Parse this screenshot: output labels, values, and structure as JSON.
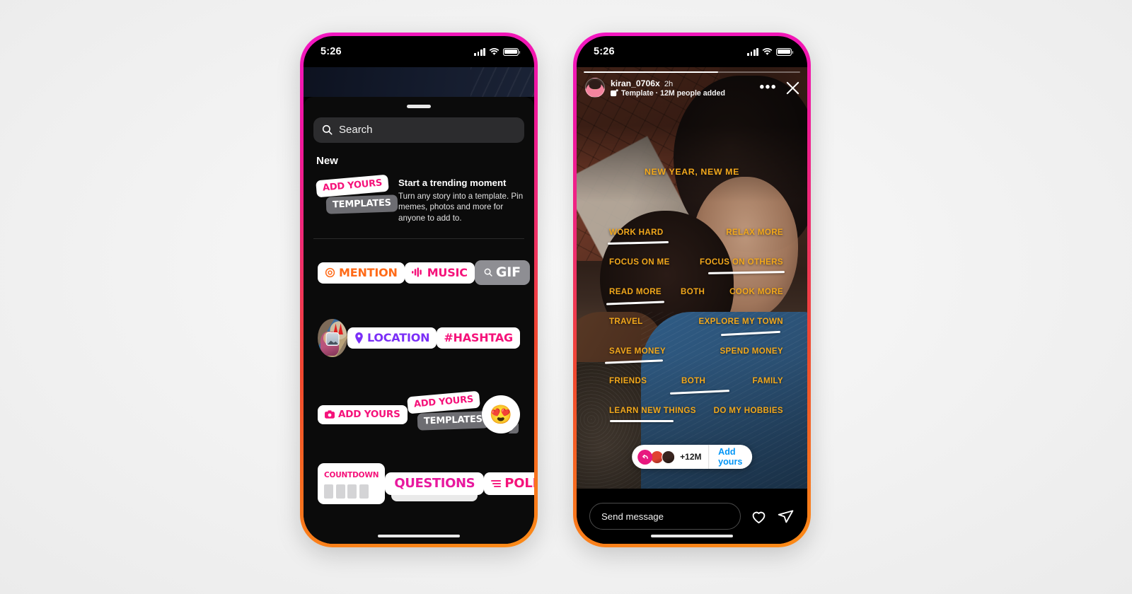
{
  "left_phone": {
    "status_bar": {
      "time": "5:26",
      "signal_icon": "cellular-bars-icon",
      "wifi_icon": "wifi-icon",
      "battery_icon": "battery-full-icon"
    },
    "sheet": {
      "grabber": "drag-handle",
      "search": {
        "placeholder": "Search",
        "icon": "search-icon"
      },
      "section_title": "New",
      "promo": {
        "sticker_top_label": "ADD YOURS",
        "sticker_bottom_label": "TEMPLATES",
        "title": "Start a trending moment",
        "body": "Turn any story into a template. Pin memes, photos and more for anyone to add to."
      },
      "stickers": {
        "row1": [
          {
            "name": "mention-sticker",
            "label": "MENTION",
            "icon": "at-threads-icon",
            "color": "#ff6a17"
          },
          {
            "name": "music-sticker",
            "label": "MUSIC",
            "icon": "music-waveform-icon",
            "color": "#f5127a"
          },
          {
            "name": "gif-sticker",
            "label": "GIF",
            "icon": "search-icon",
            "color": "#ffffff"
          }
        ],
        "row2": [
          {
            "name": "selfie-sticker",
            "label": "",
            "icon": "photo-collage-icon"
          },
          {
            "name": "location-sticker",
            "label": "LOCATION",
            "icon": "pin-icon",
            "color": "#7b2ff7"
          },
          {
            "name": "hashtag-sticker",
            "label": "#HASHTAG",
            "icon": "",
            "color": "#f5127a"
          }
        ],
        "row3": [
          {
            "name": "add-yours-sticker",
            "label": "ADD YOURS",
            "icon": "camera-icon",
            "color": "#f5127a"
          },
          {
            "name": "add-yours-templates-sticker",
            "label_top": "ADD YOURS",
            "label_bottom": "TEMPLATES"
          },
          {
            "name": "emoji-slider-sticker",
            "label": "😍",
            "icon": "heart-eyes-emoji"
          }
        ],
        "row4": [
          {
            "name": "countdown-sticker",
            "label": "COUNTDOWN",
            "color": "#f5127a"
          },
          {
            "name": "questions-sticker",
            "label": "QUESTIONS",
            "color": "#e8189e"
          },
          {
            "name": "poll-sticker",
            "label": "POLL",
            "icon": "poll-lines-icon",
            "color": "#f5127a"
          }
        ]
      }
    }
  },
  "right_phone": {
    "status_bar": {
      "time": "5:26",
      "signal_icon": "cellular-bars-icon",
      "wifi_icon": "wifi-icon",
      "battery_icon": "battery-full-icon"
    },
    "story": {
      "progress_percent": 62,
      "header": {
        "username": "kiran_0706x",
        "timestamp": "2h",
        "template_badge_icon": "template-stack-icon",
        "subtitle": "Template · 12M people added",
        "more_icon": "more-options-icon",
        "close_icon": "close-icon"
      },
      "title": "NEW YEAR, NEW ME",
      "options": [
        {
          "left": "WORK HARD",
          "center": "",
          "right": "RELAX MORE",
          "underline": "left"
        },
        {
          "left": "FOCUS ON ME",
          "center": "",
          "right": "FOCUS ON OTHERS",
          "underline": "right"
        },
        {
          "left": "READ MORE",
          "center": "BOTH",
          "right": "COOK MORE",
          "underline": "left"
        },
        {
          "left": "TRAVEL",
          "center": "",
          "right": "EXPLORE MY TOWN",
          "underline": "right"
        },
        {
          "left": "SAVE MONEY",
          "center": "",
          "right": "SPEND MONEY",
          "underline": "left"
        },
        {
          "left": "FRIENDS",
          "center": "BOTH",
          "right": "FAMILY",
          "underline": "center"
        },
        {
          "left": "LEARN NEW THINGS",
          "center": "",
          "right": "DO MY HOBBIES",
          "underline": "left"
        }
      ],
      "add_yours_pill": {
        "count_label": "+12M",
        "button_label": "Add yours",
        "ring_icon": "add-yours-arrow-icon"
      },
      "footer": {
        "message_placeholder": "Send message",
        "like_icon": "heart-icon",
        "share_icon": "paper-plane-icon"
      }
    }
  },
  "theme": {
    "frame_gradient_start": "#f318c3",
    "frame_gradient_end": "#fb8b17",
    "accent_pink": "#f5127a",
    "accent_blue": "#0095f6",
    "story_text": "#f2a81c"
  }
}
